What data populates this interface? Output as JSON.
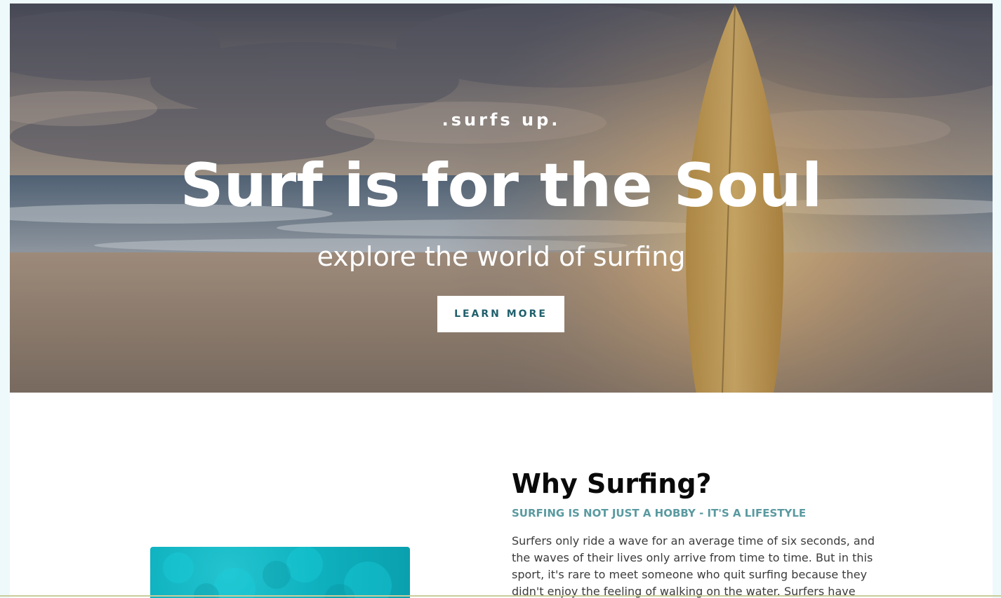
{
  "hero": {
    "eyebrow": ".surfs up.",
    "title": "Surf is for the Soul",
    "subtitle": "explore the world of surfing",
    "button_label": "LEARN MORE",
    "button_text_color": "#1f5f6b"
  },
  "why": {
    "title": "Why Surfing?",
    "subtitle": "SURFING IS NOT JUST A HOBBY - IT'S A LIFESTYLE",
    "body": "Surfers only ride a wave for an average time of six seconds, and the waves of their lives only arrive from time to time. But in this sport, it's rare to meet someone who quit surfing because they didn't enjoy the feeling of walking on the water. Surfers have",
    "subtitle_color": "#5a9aa0",
    "image_color": "#0fb2c0"
  }
}
